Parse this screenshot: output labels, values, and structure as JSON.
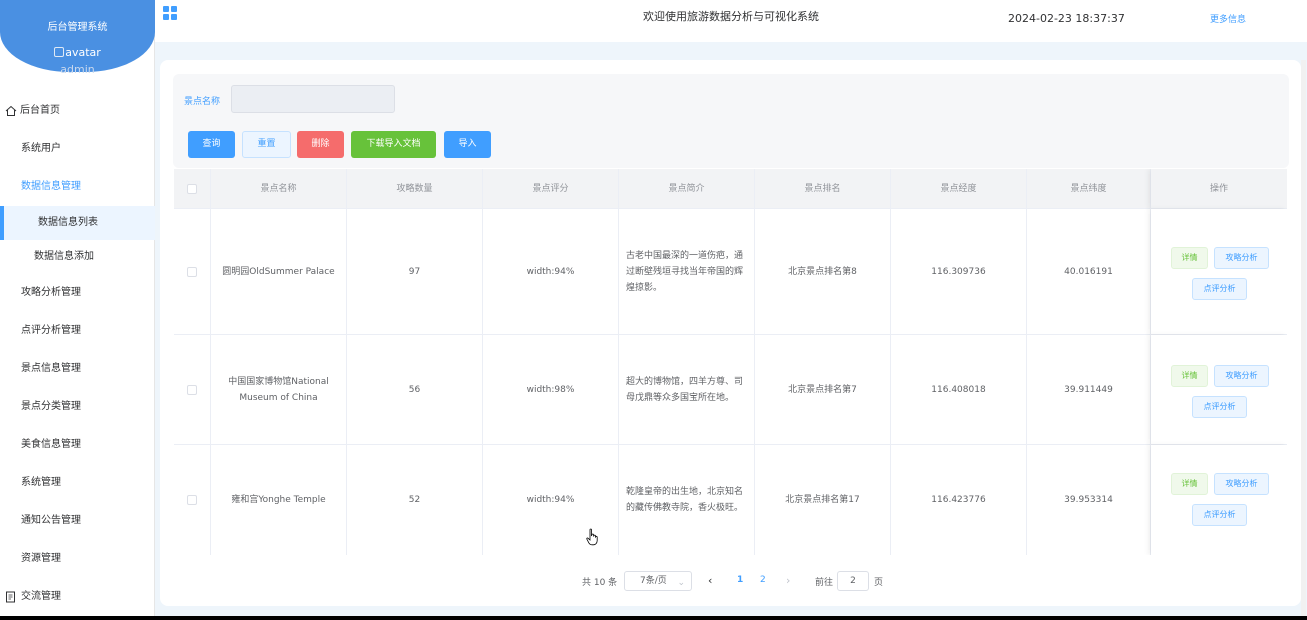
{
  "sidebar": {
    "system_title": "后台管理系统",
    "avatar_alt": "avatar",
    "username": "admin",
    "items": [
      {
        "label": "后台首页"
      },
      {
        "label": "系统用户"
      },
      {
        "label": "数据信息管理"
      },
      {
        "label": "数据信息列表"
      },
      {
        "label": "数据信息添加"
      },
      {
        "label": "攻略分析管理"
      },
      {
        "label": "点评分析管理"
      },
      {
        "label": "景点信息管理"
      },
      {
        "label": "景点分类管理"
      },
      {
        "label": "美食信息管理"
      },
      {
        "label": "系统管理"
      },
      {
        "label": "通知公告管理"
      },
      {
        "label": "资源管理"
      },
      {
        "label": "交流管理"
      }
    ]
  },
  "header": {
    "title": "欢迎使用旅游数据分析与可视化系统",
    "datetime": "2024-02-23 18:37:37",
    "more": "更多信息"
  },
  "search": {
    "label": "景点名称",
    "value": "",
    "buttons": {
      "query": "查询",
      "reset": "重置",
      "delete": "删除",
      "download": "下载导入文档",
      "import": "导入"
    }
  },
  "table": {
    "columns": [
      "景点名称",
      "攻略数量",
      "景点评分",
      "景点简介",
      "景点排名",
      "景点经度",
      "景点纬度",
      "操作"
    ],
    "rows": [
      {
        "name": "圆明园OldSummer Palace",
        "count": "97",
        "rating": "width:94%",
        "intro": "古老中国最深的一道伤疤，通过断壁残垣寻找当年帝国的辉煌掠影。",
        "rank": "北京景点排名第8",
        "lng": "116.309736",
        "lat": "40.016191"
      },
      {
        "name": "中国国家博物馆National Museum of China",
        "count": "56",
        "rating": "width:98%",
        "intro": "超大的博物馆，四羊方尊、司母戊鼎等众多国宝所在地。",
        "rank": "北京景点排名第7",
        "lng": "116.408018",
        "lat": "39.911449"
      },
      {
        "name": "雍和宫Yonghe Temple",
        "count": "52",
        "rating": "width:94%",
        "intro": "乾隆皇帝的出生地，北京知名的藏传佛教寺院，香火极旺。",
        "rank": "北京景点排名第17",
        "lng": "116.423776",
        "lat": "39.953314"
      }
    ],
    "actions": {
      "detail": "详情",
      "strategy": "攻略分析",
      "review": "点评分析"
    }
  },
  "pagination": {
    "total": "共 10 条",
    "page_size": "7条/页",
    "pages": [
      "1",
      "2"
    ],
    "current_page": 1,
    "goto_label": "前往",
    "goto_value": "2",
    "page_suffix": "页"
  },
  "colors": {
    "primary": "#409eff",
    "danger": "#f56c6c",
    "success": "#67c23a",
    "logo": "#4a90e2"
  }
}
